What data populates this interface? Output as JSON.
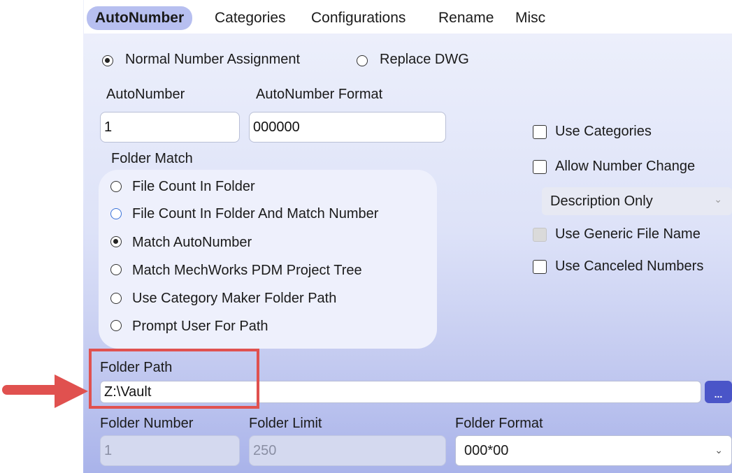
{
  "tabs": {
    "items": [
      {
        "label": "AutoNumber"
      },
      {
        "label": "Categories"
      },
      {
        "label": "Configurations"
      },
      {
        "label": "Rename"
      },
      {
        "label": "Misc"
      }
    ]
  },
  "assignment": {
    "normal_label": "Normal Number Assignment",
    "replace_label": "Replace DWG",
    "selected": "Normal Number Assignment"
  },
  "autonumber": {
    "label": "AutoNumber",
    "value": "1",
    "format_label": "AutoNumber Format",
    "format_value": "000000"
  },
  "folder_match": {
    "label": "Folder Match",
    "options": [
      {
        "label": "File Count In Folder",
        "selected": false
      },
      {
        "label": "File Count In Folder And Match Number",
        "selected": false
      },
      {
        "label": "Match AutoNumber",
        "selected": true
      },
      {
        "label": "Match MechWorks PDM Project Tree",
        "selected": false
      },
      {
        "label": "Use Category Maker Folder Path",
        "selected": false
      },
      {
        "label": "Prompt User For Path",
        "selected": false
      }
    ]
  },
  "options": {
    "use_categories": {
      "label": "Use Categories",
      "checked": false
    },
    "allow_number_change": {
      "label": "Allow Number Change",
      "checked": false
    },
    "change_mode": {
      "value": "Description Only"
    },
    "use_generic_file_name": {
      "label": "Use Generic File Name",
      "checked": false,
      "enabled": false
    },
    "use_canceled_numbers": {
      "label": "Use Canceled Numbers",
      "checked": false
    }
  },
  "folder_path": {
    "label": "Folder Path",
    "value": "Z:\\Vault",
    "browse_label": "..."
  },
  "folder": {
    "number_label": "Folder Number",
    "number_value": "1",
    "limit_label": "Folder Limit",
    "limit_value": "250",
    "format_label": "Folder Format",
    "format_value": "000*00"
  },
  "colors": {
    "active_tab": "#b7bff0",
    "browse_button": "#4a55c8",
    "highlight": "#e0514f",
    "arrow": "#e0514f"
  }
}
